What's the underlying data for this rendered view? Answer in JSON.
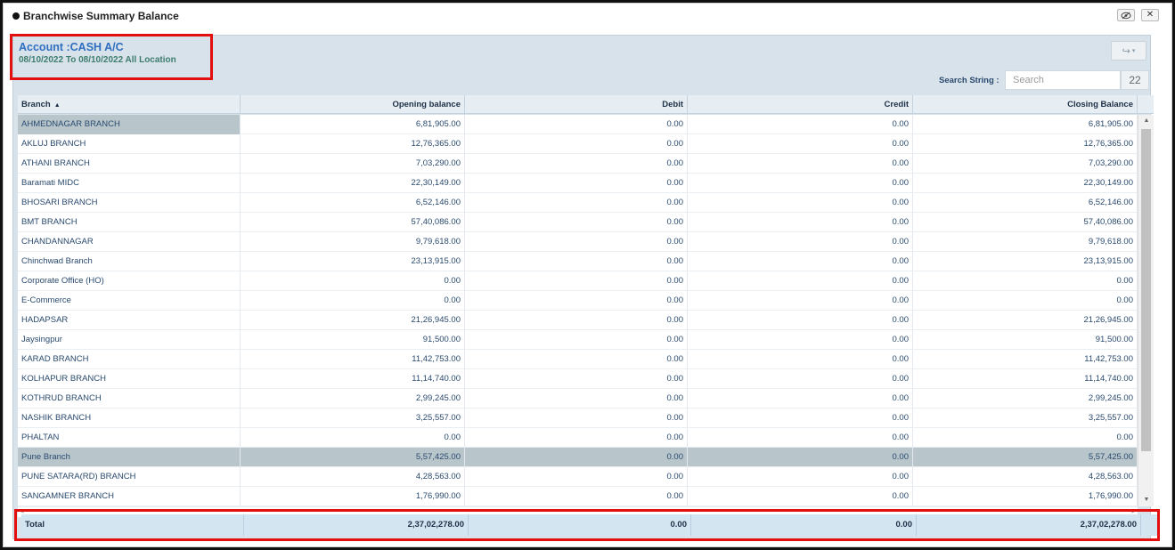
{
  "window": {
    "title": "Branchwise Summary Balance",
    "eye_button": "👁",
    "close_button": "✕"
  },
  "account": {
    "title": "Account :CASH A/C",
    "subtitle": "08/10/2022 To 08/10/2022 All Location"
  },
  "toolbar": {
    "share_icon": "↪",
    "share_caret": "▾"
  },
  "search": {
    "label": "Search String :",
    "placeholder": "Search",
    "value": "",
    "count": "22"
  },
  "table": {
    "columns": [
      "Branch",
      "Opening balance",
      "Debit",
      "Credit",
      "Closing Balance"
    ],
    "sort_indicator": "▲",
    "rows": [
      [
        "AHMEDNAGAR BRANCH",
        "6,81,905.00",
        "0.00",
        "0.00",
        "6,81,905.00"
      ],
      [
        "AKLUJ BRANCH",
        "12,76,365.00",
        "0.00",
        "0.00",
        "12,76,365.00"
      ],
      [
        "ATHANI BRANCH",
        "7,03,290.00",
        "0.00",
        "0.00",
        "7,03,290.00"
      ],
      [
        "Baramati MIDC",
        "22,30,149.00",
        "0.00",
        "0.00",
        "22,30,149.00"
      ],
      [
        "BHOSARI BRANCH",
        "6,52,146.00",
        "0.00",
        "0.00",
        "6,52,146.00"
      ],
      [
        "BMT BRANCH",
        "57,40,086.00",
        "0.00",
        "0.00",
        "57,40,086.00"
      ],
      [
        "CHANDANNAGAR",
        "9,79,618.00",
        "0.00",
        "0.00",
        "9,79,618.00"
      ],
      [
        "Chinchwad Branch",
        "23,13,915.00",
        "0.00",
        "0.00",
        "23,13,915.00"
      ],
      [
        "Corporate Office (HO)",
        "0.00",
        "0.00",
        "0.00",
        "0.00"
      ],
      [
        "E-Commerce",
        "0.00",
        "0.00",
        "0.00",
        "0.00"
      ],
      [
        "HADAPSAR",
        "21,26,945.00",
        "0.00",
        "0.00",
        "21,26,945.00"
      ],
      [
        "Jaysingpur",
        "91,500.00",
        "0.00",
        "0.00",
        "91,500.00"
      ],
      [
        "KARAD BRANCH",
        "11,42,753.00",
        "0.00",
        "0.00",
        "11,42,753.00"
      ],
      [
        "KOLHAPUR BRANCH",
        "11,14,740.00",
        "0.00",
        "0.00",
        "11,14,740.00"
      ],
      [
        "KOTHRUD BRANCH",
        "2,99,245.00",
        "0.00",
        "0.00",
        "2,99,245.00"
      ],
      [
        "NASHIK BRANCH",
        "3,25,557.00",
        "0.00",
        "0.00",
        "3,25,557.00"
      ],
      [
        "PHALTAN",
        "0.00",
        "0.00",
        "0.00",
        "0.00"
      ],
      [
        "Pune Branch",
        "5,57,425.00",
        "0.00",
        "0.00",
        "5,57,425.00"
      ],
      [
        "PUNE SATARA(RD) BRANCH",
        "4,28,563.00",
        "0.00",
        "0.00",
        "4,28,563.00"
      ],
      [
        "SANGAMNER BRANCH",
        "1,76,990.00",
        "0.00",
        "0.00",
        "1,76,990.00"
      ]
    ],
    "selected_row": 0,
    "highlighted_row": 17,
    "total": [
      "Total",
      "2,37,02,278.00",
      "0.00",
      "0.00",
      "2,37,02,278.00"
    ]
  },
  "colors": {
    "annotation_red": "#e30e0e",
    "account_blue": "#2f6fc0",
    "subtitle_green": "#3e7d6e",
    "panel_bg": "#d8e2ea",
    "row_highlight": "#b8c6cc",
    "total_bg": "#d4e5f2"
  }
}
